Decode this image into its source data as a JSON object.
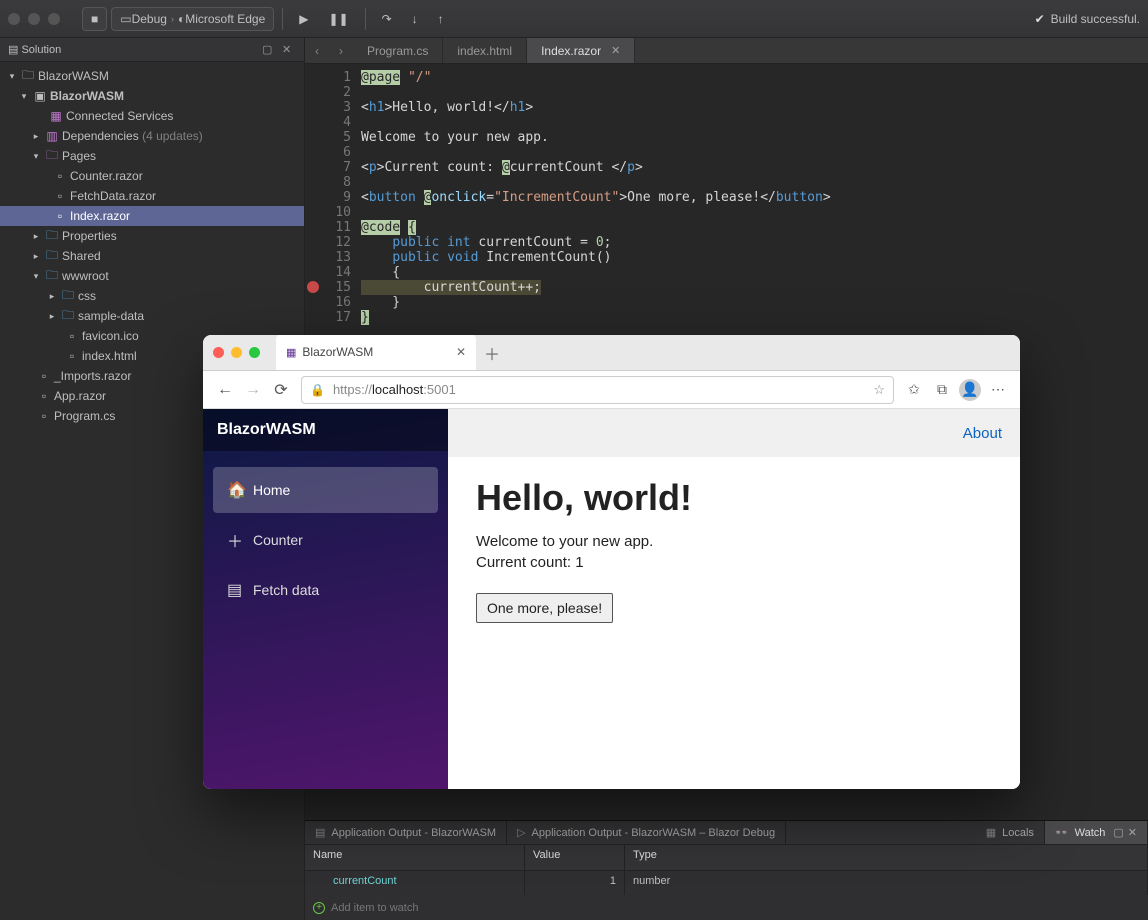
{
  "toolbar": {
    "stop_icon": "stop",
    "config": "Debug",
    "target": "Microsoft Edge",
    "status_text": "Build successful."
  },
  "solution": {
    "title": "Solution",
    "root": "BlazorWASM",
    "project": "BlazorWASM",
    "nodes": {
      "connected": "Connected Services",
      "dependencies": "Dependencies",
      "dependencies_note": "(4 updates)",
      "pages": "Pages",
      "pages_counter": "Counter.razor",
      "pages_fetch": "FetchData.razor",
      "pages_index": "Index.razor",
      "properties": "Properties",
      "shared": "Shared",
      "wwwroot": "wwwroot",
      "css": "css",
      "sampledata": "sample-data",
      "favicon": "favicon.ico",
      "indexhtml": "index.html",
      "imports": "_Imports.razor",
      "app": "App.razor",
      "program": "Program.cs"
    }
  },
  "tabs": {
    "t1": "Program.cs",
    "t2": "index.html",
    "t3": "Index.razor"
  },
  "debug": {
    "tabs": {
      "out1": "Application Output - BlazorWASM",
      "out2": "Application Output - BlazorWASM – Blazor Debug",
      "locals": "Locals",
      "watch": "Watch"
    },
    "headers": {
      "name": "Name",
      "value": "Value",
      "type": "Type"
    },
    "row": {
      "name": "currentCount",
      "value": "1",
      "type": "number"
    },
    "add": "Add item to watch"
  },
  "browser": {
    "tab_title": "BlazorWASM",
    "url_host": "localhost",
    "url_prefix": "https://",
    "url_port": ":5001",
    "brand": "BlazorWASM",
    "nav": {
      "home": "Home",
      "counter": "Counter",
      "fetch": "Fetch data"
    },
    "about": "About",
    "h1": "Hello, world!",
    "welcome": "Welcome to your new app.",
    "count_line": "Current count: 1",
    "button": "One more, please!"
  }
}
